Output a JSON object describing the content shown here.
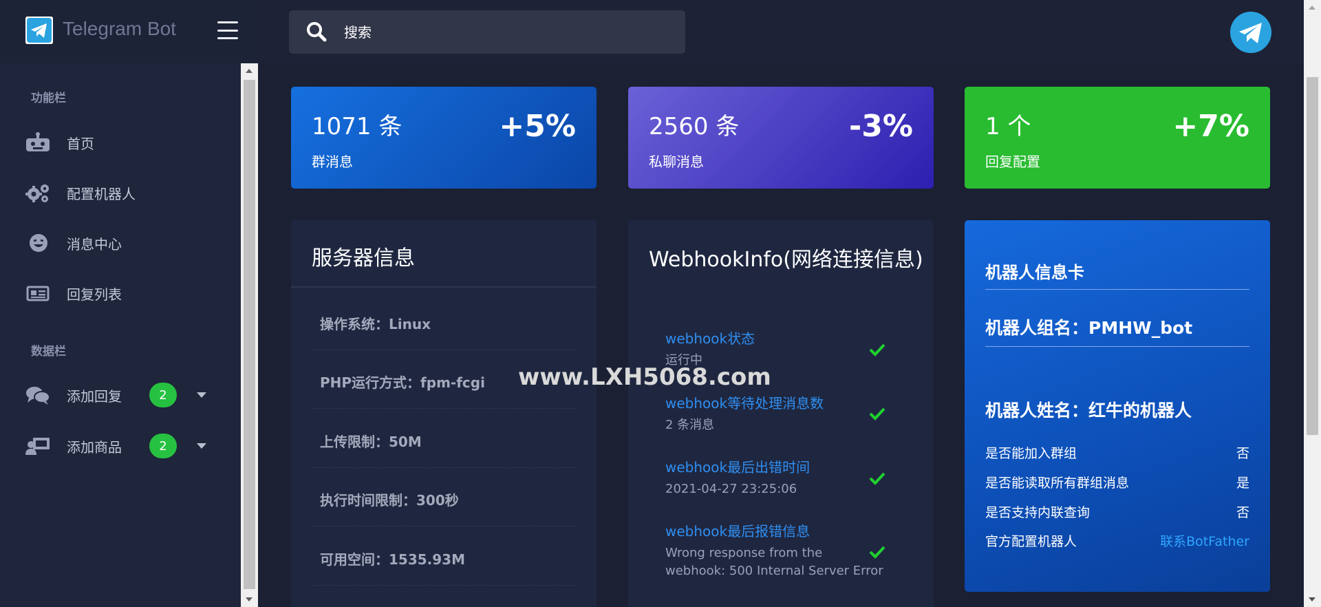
{
  "brand": {
    "title": "Telegram Bot"
  },
  "sidebar": {
    "section1": "功能栏",
    "section2": "数据栏",
    "items": [
      {
        "label": "首页",
        "icon": "robot-icon"
      },
      {
        "label": "配置机器人",
        "icon": "gears-icon"
      },
      {
        "label": "消息中心",
        "icon": "smile-icon"
      },
      {
        "label": "回复列表",
        "icon": "newspaper-icon"
      },
      {
        "label": "添加回复",
        "icon": "comments-icon",
        "badge": "2"
      },
      {
        "label": "添加商品",
        "icon": "user-board-icon",
        "badge": "2"
      }
    ]
  },
  "search": {
    "placeholder": "搜索"
  },
  "stats": [
    {
      "value": "1071 条",
      "label": "群消息",
      "pct": "+5%"
    },
    {
      "value": "2560 条",
      "label": "私聊消息",
      "pct": "-3%"
    },
    {
      "value": "1 个",
      "label": "回复配置",
      "pct": "+7%"
    }
  ],
  "server": {
    "title": "服务器信息",
    "items": [
      "操作系统：Linux",
      "PHP运行方式：fpm-fcgi",
      "上传限制：50M",
      "执行时间限制：300秒",
      "可用空间：1535.93M"
    ]
  },
  "webhook": {
    "title": "WebhookInfo(网络连接信息)",
    "items": [
      {
        "label": "webhook状态",
        "value": "运行中"
      },
      {
        "label": "webhook等待处理消息数",
        "value": "2 条消息"
      },
      {
        "label": "webhook最后出错时间",
        "value": "2021-04-27 23:25:06"
      },
      {
        "label": "webhook最后报错信息",
        "value": "Wrong response from the webhook: 500 Internal Server Error"
      }
    ]
  },
  "bot": {
    "title": "机器人信息卡",
    "group_name": "机器人组名：PMHW_bot",
    "name": "机器人姓名：红牛的机器人",
    "rows": [
      {
        "label": "是否能加入群组",
        "value": "否"
      },
      {
        "label": "是否能读取所有群组消息",
        "value": "是"
      },
      {
        "label": "是否支持内联查询",
        "value": "否"
      },
      {
        "label": "官方配置机器人",
        "value": "联系BotFather"
      }
    ]
  },
  "watermark": "www.LXH5068.com",
  "colors": {
    "accent_blue": "#1670df",
    "accent_purple": "#6b61d6",
    "accent_green": "#29bc31",
    "link": "#2f8ef0",
    "check": "#1fd12f"
  }
}
